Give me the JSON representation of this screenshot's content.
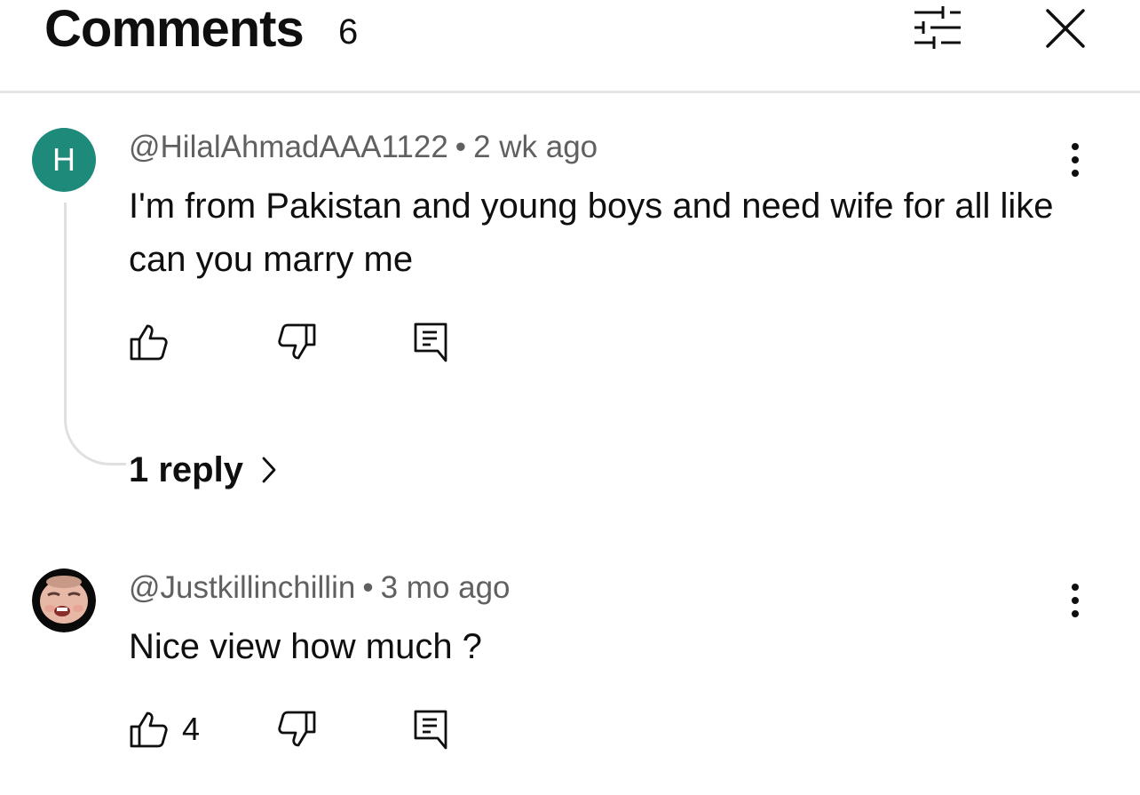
{
  "header": {
    "title": "Comments",
    "count": "6",
    "filter_icon": "sliders-icon",
    "close_icon": "close-icon"
  },
  "comments": [
    {
      "author": "@HilalAhmadAAA1122",
      "time": "2 wk ago",
      "text": "I'm from Pakistan and young boys and need wife for all like can you marry me",
      "avatar_letter": "H",
      "avatar_color": "#1e8a7a",
      "likes": "",
      "replies_label": "1 reply"
    },
    {
      "author": "@Justkillinchillin",
      "time": "3 mo ago",
      "text": "Nice view how much ?",
      "avatar_icon": "profile-photo",
      "likes": "4"
    }
  ],
  "colors": {
    "text_primary": "#0f0f0f",
    "text_secondary": "#606060",
    "divider": "#e5e5e5"
  }
}
